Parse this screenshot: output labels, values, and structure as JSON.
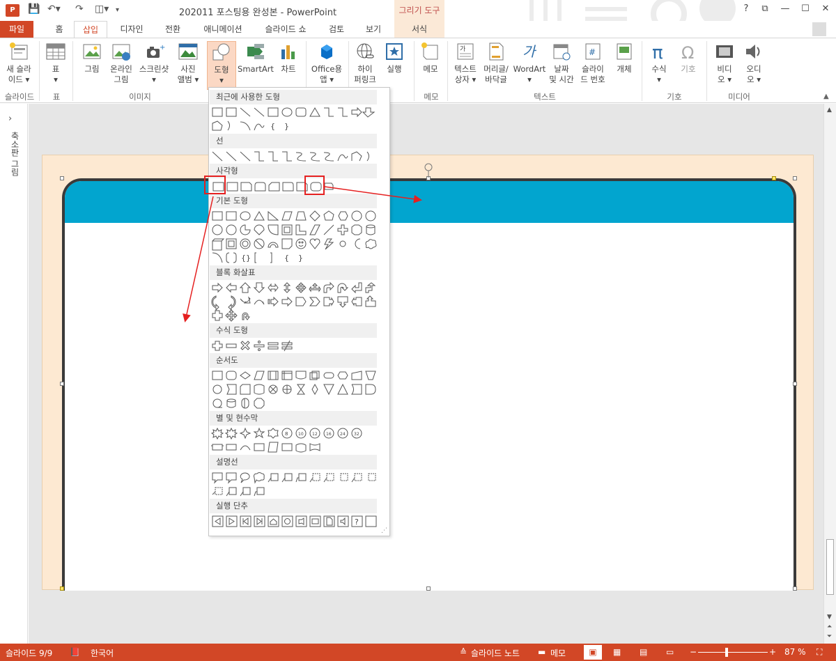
{
  "window": {
    "title": "202011 포스팅용 완성본 - PowerPoint",
    "app_badge": "P",
    "context_tab_title": "그리기 도구",
    "help": "?",
    "restore": "⧉",
    "minimize": "—",
    "maximize": "☐",
    "close": "✕"
  },
  "tabs": [
    "파일",
    "홈",
    "삽입",
    "디자인",
    "전환",
    "애니메이션",
    "슬라이드 쇼",
    "검토",
    "보기",
    "서식"
  ],
  "ribbon": {
    "groups": [
      "슬라이드",
      "표",
      "이미지",
      "메모",
      "텍스트",
      "기호",
      "미디어"
    ],
    "buttons": {
      "new_slide": [
        "새 슬라",
        "이드 ▾"
      ],
      "table": [
        "표",
        "▾"
      ],
      "picture": [
        "그림"
      ],
      "online_picture": [
        "온라인",
        "그림"
      ],
      "screenshot": [
        "스크린샷",
        "▾"
      ],
      "photo_album": [
        "사진",
        "앨범 ▾"
      ],
      "shapes": [
        "도형",
        "▾"
      ],
      "smartart": [
        "SmartArt"
      ],
      "chart": [
        "차트"
      ],
      "office_apps": [
        "Office용",
        "앱 ▾"
      ],
      "hyperlink": [
        "하이",
        "퍼링크"
      ],
      "action": [
        "실행"
      ],
      "comment": [
        "메모"
      ],
      "textbox": [
        "텍스트",
        "상자 ▾"
      ],
      "header_footer": [
        "머리글/",
        "바닥글"
      ],
      "wordart": [
        "WordArt",
        "▾"
      ],
      "datetime": [
        "날짜",
        "및 시간"
      ],
      "slide_number": [
        "슬라이",
        "드 번호"
      ],
      "object": [
        "개체"
      ],
      "equation": [
        "수식",
        "▾"
      ],
      "symbol": [
        "기호"
      ],
      "video": [
        "비디",
        "오 ▾"
      ],
      "audio": [
        "오디",
        "오 ▾"
      ]
    }
  },
  "left_pane": {
    "label": "축소판 그림",
    "expand_icon": "›"
  },
  "shapes_menu": {
    "sections": [
      "최근에 사용한 도형",
      "선",
      "사각형",
      "기본 도형",
      "블록 화살표",
      "수식 도형",
      "순서도",
      "별 및 현수막",
      "설명선",
      "실행 단추"
    ]
  },
  "statusbar": {
    "slide_info": "슬라이드 9/9",
    "language": "한국어",
    "notes": "슬라이드 노트",
    "comments": "메모",
    "zoom_minus": "−",
    "zoom_plus": "+",
    "zoom": "87 %"
  },
  "colors": {
    "accent": "#d24726",
    "slide_bg": "#fde9d2",
    "band": "#02a5cf",
    "annotation": "#e52020"
  }
}
